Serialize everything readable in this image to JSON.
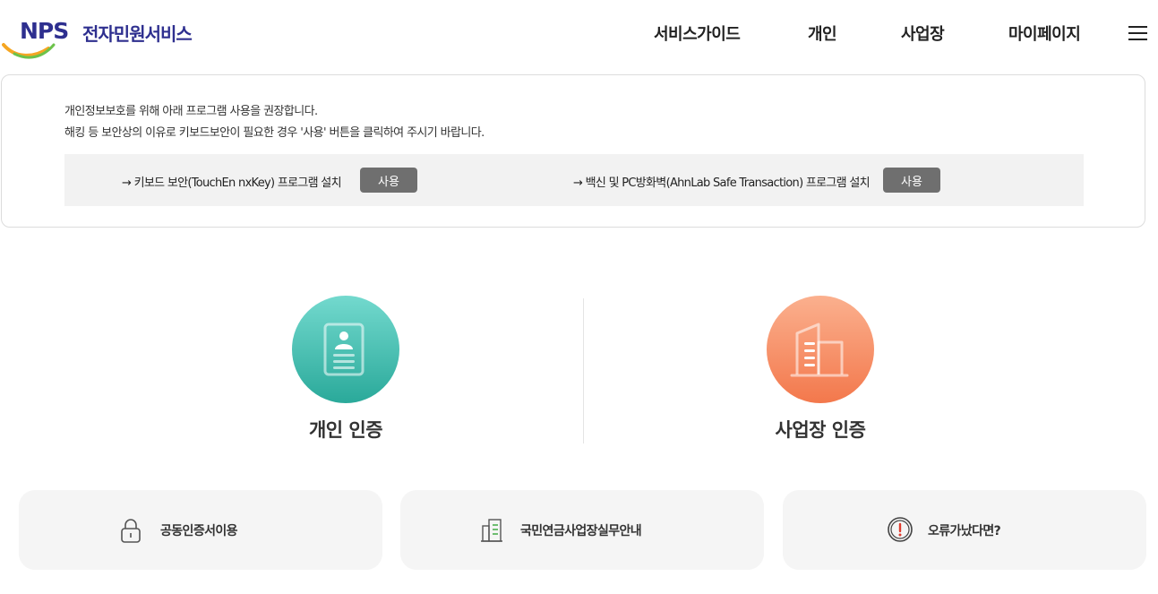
{
  "header": {
    "logo_mark": "NPS",
    "logo_text": "전자민원서비스",
    "nav": [
      "서비스가이드",
      "개인",
      "사업장",
      "마이페이지"
    ],
    "menu_icon": "hamburger-icon"
  },
  "notice": {
    "line1": "개인정보보호를 위해 아래 프로그램 사용을 권장합니다.",
    "line2": "해킹 등 보안상의 이유로 키보드보안이 필요한 경우 '사용' 버튼을 클릭하여 주시기 바랍니다.",
    "programs": [
      {
        "label": "→ 키보드 보안(TouchEn nxKey) 프로그램 설치",
        "button": "사용"
      },
      {
        "label": "→ 백신 및 PC방화벽(AhnLab Safe Transaction) 프로그램 설치",
        "button": "사용"
      }
    ]
  },
  "auth": {
    "personal": {
      "label": "개인 인증",
      "icon": "id-card-icon",
      "color": "#3bbcad"
    },
    "business": {
      "label": "사업장 인증",
      "icon": "building-icon",
      "color": "#f7895c"
    }
  },
  "quick_links": [
    {
      "label": "공동인증서이용",
      "icon": "lock-icon"
    },
    {
      "label": "국민연금사업장실무안내",
      "icon": "document-icon"
    },
    {
      "label": "오류가났다면?",
      "icon": "warning-icon"
    }
  ],
  "colors": {
    "brand": "#2e2f8f",
    "button_gray": "#6f6f6f",
    "card_bg": "#f5f5f5",
    "warning_red": "#e03b2e",
    "doc_green": "#4caf50"
  }
}
